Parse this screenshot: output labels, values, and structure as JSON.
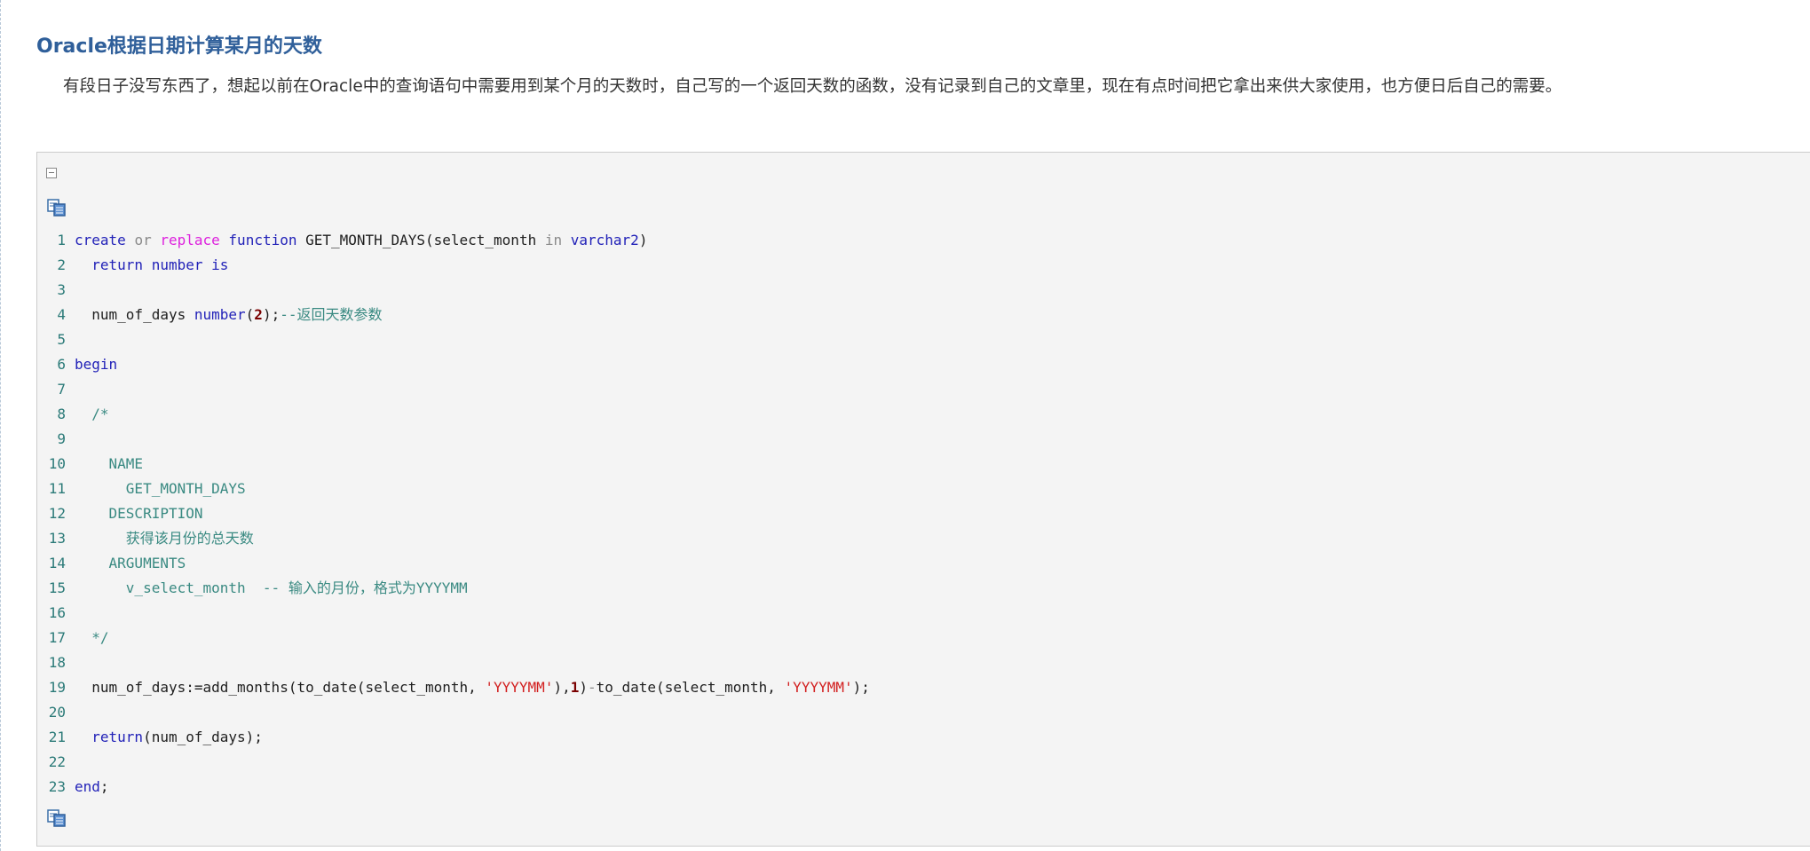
{
  "article": {
    "title": "Oracle根据日期计算某月的天数",
    "intro": "有段日子没写东西了，想起以前在Oracle中的查询语句中需要用到某个月的天数时，自己写的一个返回天数的函数，没有记录到自己的文章里，现在有点时间把它拿出来供大家使用，也方便日后自己的需要。"
  },
  "code_block": {
    "collapse_icon": "collapse-minus-icon",
    "copy_icon": "copy-code-icon",
    "colors": {
      "keyword": "#2222b8",
      "operator_word": "#8a8a8a",
      "replace_keyword": "#dd22dd",
      "comment": "#3a8a82",
      "string": "#d21f1f",
      "number": "#7a0000",
      "line_number": "#2b7a78",
      "background": "#f4f4f4"
    },
    "lines": [
      {
        "no": "1",
        "tokens": [
          {
            "t": "kw",
            "v": "create"
          },
          {
            "t": "pl",
            "v": " "
          },
          {
            "t": "op",
            "v": "or"
          },
          {
            "t": "pl",
            "v": " "
          },
          {
            "t": "mg",
            "v": "replace"
          },
          {
            "t": "pl",
            "v": " "
          },
          {
            "t": "kw",
            "v": "function"
          },
          {
            "t": "pl",
            "v": " GET_MONTH_DAYS(select_month "
          },
          {
            "t": "op",
            "v": "in"
          },
          {
            "t": "pl",
            "v": " "
          },
          {
            "t": "kw",
            "v": "varchar2"
          },
          {
            "t": "pl",
            "v": ")"
          }
        ]
      },
      {
        "no": "2",
        "tokens": [
          {
            "t": "pl",
            "v": "  "
          },
          {
            "t": "kw",
            "v": "return"
          },
          {
            "t": "pl",
            "v": " "
          },
          {
            "t": "kw",
            "v": "number"
          },
          {
            "t": "pl",
            "v": " "
          },
          {
            "t": "kw",
            "v": "is"
          }
        ]
      },
      {
        "no": "3",
        "tokens": []
      },
      {
        "no": "4",
        "tokens": [
          {
            "t": "pl",
            "v": "  num_of_days "
          },
          {
            "t": "kw",
            "v": "number"
          },
          {
            "t": "pl",
            "v": "("
          },
          {
            "t": "nm",
            "v": "2"
          },
          {
            "t": "pl",
            "v": ");"
          },
          {
            "t": "cm",
            "v": "--返回天数参数"
          }
        ]
      },
      {
        "no": "5",
        "tokens": []
      },
      {
        "no": "6",
        "tokens": [
          {
            "t": "kw",
            "v": "begin"
          }
        ]
      },
      {
        "no": "7",
        "tokens": []
      },
      {
        "no": "8",
        "tokens": [
          {
            "t": "cm",
            "v": "  /*"
          }
        ]
      },
      {
        "no": "9",
        "tokens": []
      },
      {
        "no": "10",
        "tokens": [
          {
            "t": "cm",
            "v": "    NAME"
          }
        ]
      },
      {
        "no": "11",
        "tokens": [
          {
            "t": "cm",
            "v": "      GET_MONTH_DAYS"
          }
        ]
      },
      {
        "no": "12",
        "tokens": [
          {
            "t": "cm",
            "v": "    DESCRIPTION"
          }
        ]
      },
      {
        "no": "13",
        "tokens": [
          {
            "t": "cm",
            "v": "      获得该月份的总天数"
          }
        ]
      },
      {
        "no": "14",
        "tokens": [
          {
            "t": "cm",
            "v": "    ARGUMENTS"
          }
        ]
      },
      {
        "no": "15",
        "tokens": [
          {
            "t": "cm",
            "v": "      v_select_month  -- 输入的月份，格式为YYYYMM"
          }
        ]
      },
      {
        "no": "16",
        "tokens": []
      },
      {
        "no": "17",
        "tokens": [
          {
            "t": "cm",
            "v": "  */"
          }
        ]
      },
      {
        "no": "18",
        "tokens": []
      },
      {
        "no": "19",
        "tokens": [
          {
            "t": "pl",
            "v": "  num_of_days:=add_months(to_date(select_month, "
          },
          {
            "t": "st",
            "v": "'YYYYMM'"
          },
          {
            "t": "pl",
            "v": "),"
          },
          {
            "t": "nm",
            "v": "1"
          },
          {
            "t": "pl",
            "v": ")"
          },
          {
            "t": "op",
            "v": "-"
          },
          {
            "t": "pl",
            "v": "to_date(select_month, "
          },
          {
            "t": "st",
            "v": "'YYYYMM'"
          },
          {
            "t": "pl",
            "v": ");"
          }
        ]
      },
      {
        "no": "20",
        "tokens": []
      },
      {
        "no": "21",
        "tokens": [
          {
            "t": "pl",
            "v": "  "
          },
          {
            "t": "kw",
            "v": "return"
          },
          {
            "t": "pl",
            "v": "(num_of_days);"
          }
        ]
      },
      {
        "no": "22",
        "tokens": []
      },
      {
        "no": "23",
        "tokens": [
          {
            "t": "kw",
            "v": "end"
          },
          {
            "t": "pl",
            "v": ";"
          }
        ]
      }
    ]
  }
}
